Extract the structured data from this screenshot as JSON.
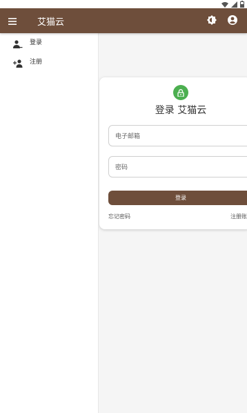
{
  "app": {
    "title": "艾猫云",
    "accent_color": "#6e4e3b"
  },
  "sidebar": {
    "items": [
      {
        "icon": "person-icon",
        "label": "登录"
      },
      {
        "icon": "person-add-icon",
        "label": "注册"
      }
    ]
  },
  "login": {
    "title": "登录 艾猫云",
    "email_placeholder": "电子邮箱",
    "password_placeholder": "密码",
    "submit_label": "登录",
    "forgot_label": "忘记密码",
    "register_label": "注册账"
  }
}
